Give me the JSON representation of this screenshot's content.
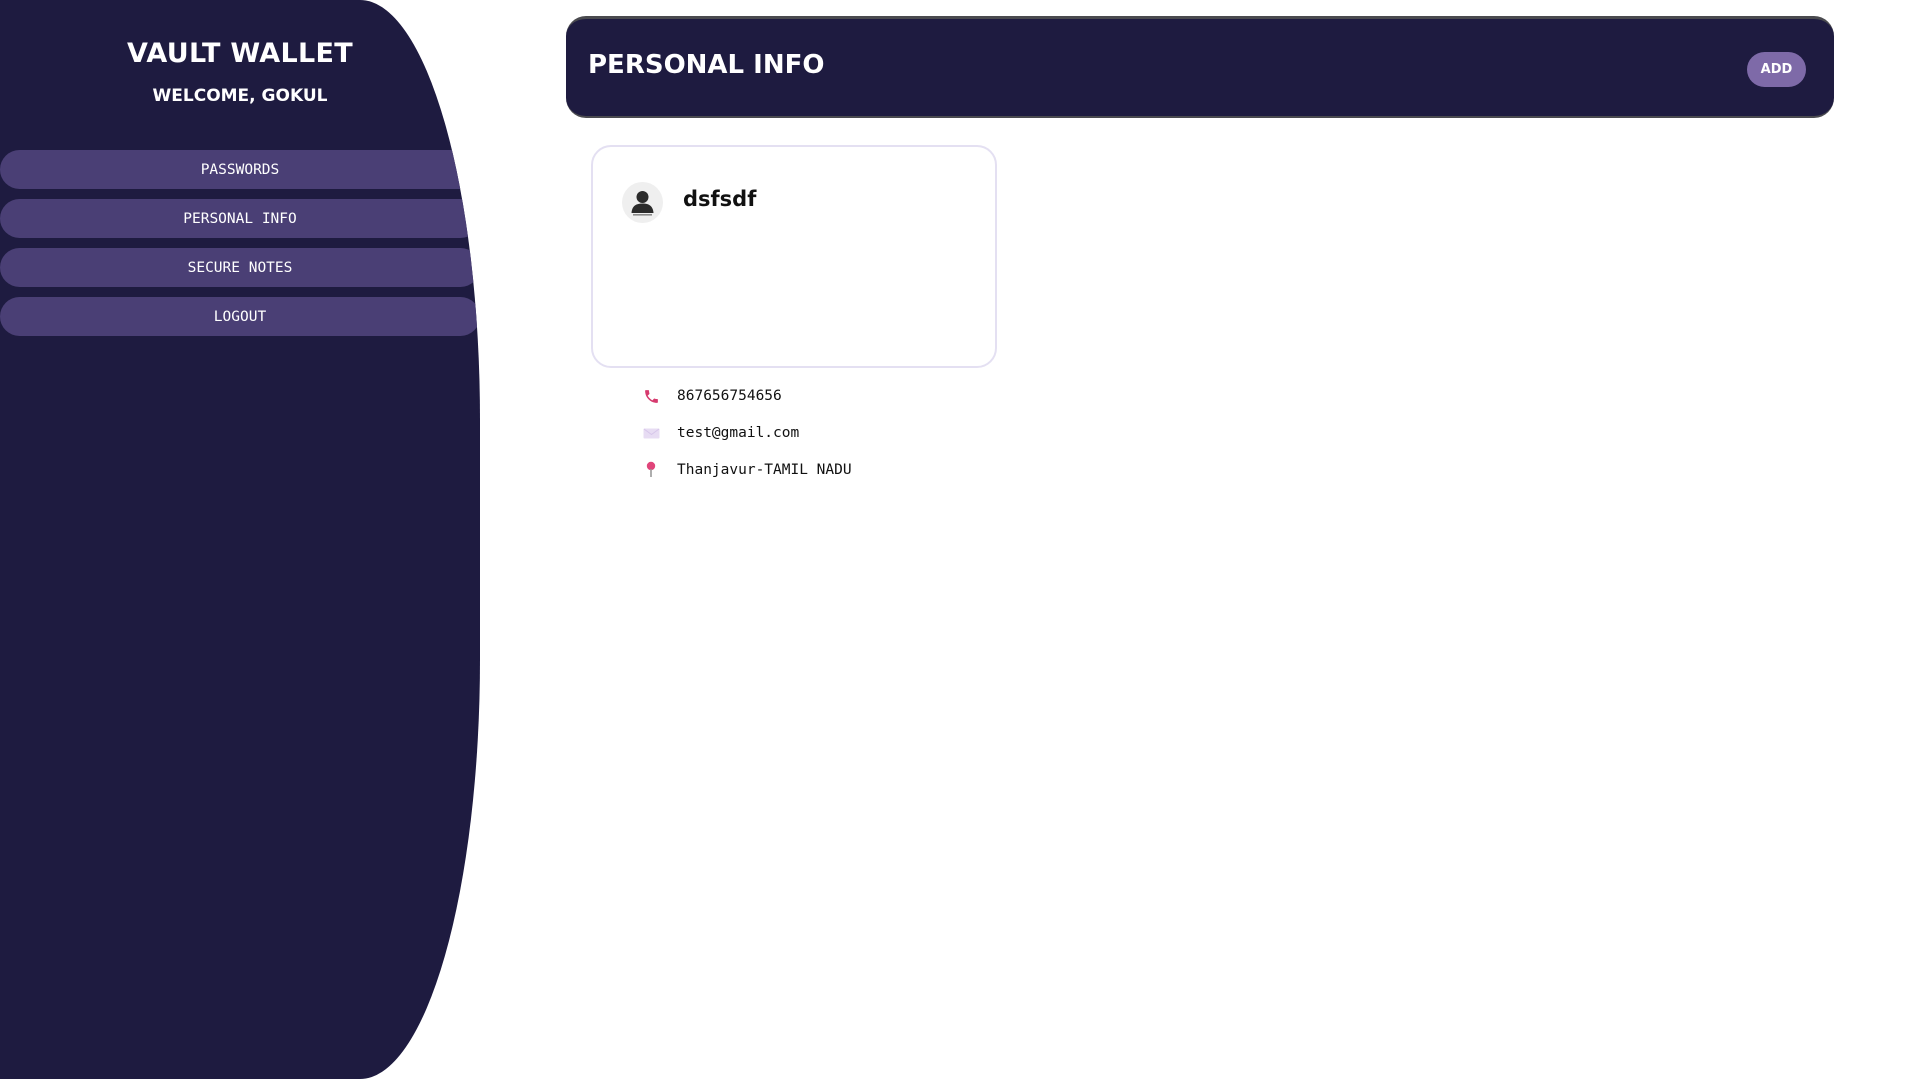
{
  "app": {
    "title": "VAULT WALLET",
    "welcome": "WELCOME, GOKUL"
  },
  "sidebar": {
    "items": [
      {
        "label": "PASSWORDS",
        "icon": "none"
      },
      {
        "label": "PERSONAL INFO",
        "icon": "none"
      },
      {
        "label": "SECURE NOTES",
        "icon": "none"
      },
      {
        "label": "LOGOUT",
        "icon": "none"
      }
    ]
  },
  "header": {
    "title": "PERSONAL INFO",
    "add_label": "ADD"
  },
  "cards": [
    {
      "name": "dsfsdf",
      "avatar_icon": "user-avatar-icon",
      "phone": "867656754656",
      "phone_icon": "phone-icon",
      "email": "test@gmail.com",
      "email_icon": "envelope-icon",
      "location": "Thanjavur-TAMIL NADU",
      "location_icon": "location-pin-icon"
    }
  ],
  "colors": {
    "sidebar_bg": "#1e1b40",
    "nav_item_bg": "#4a3f75",
    "header_bg": "#1e1b40",
    "add_button_bg": "#7e6aa8",
    "card_border": "#e4e0f2",
    "phone_icon": "#d63a6e",
    "pin_icon": "#e0457a",
    "envelope_icon": "#e7dcf3"
  }
}
